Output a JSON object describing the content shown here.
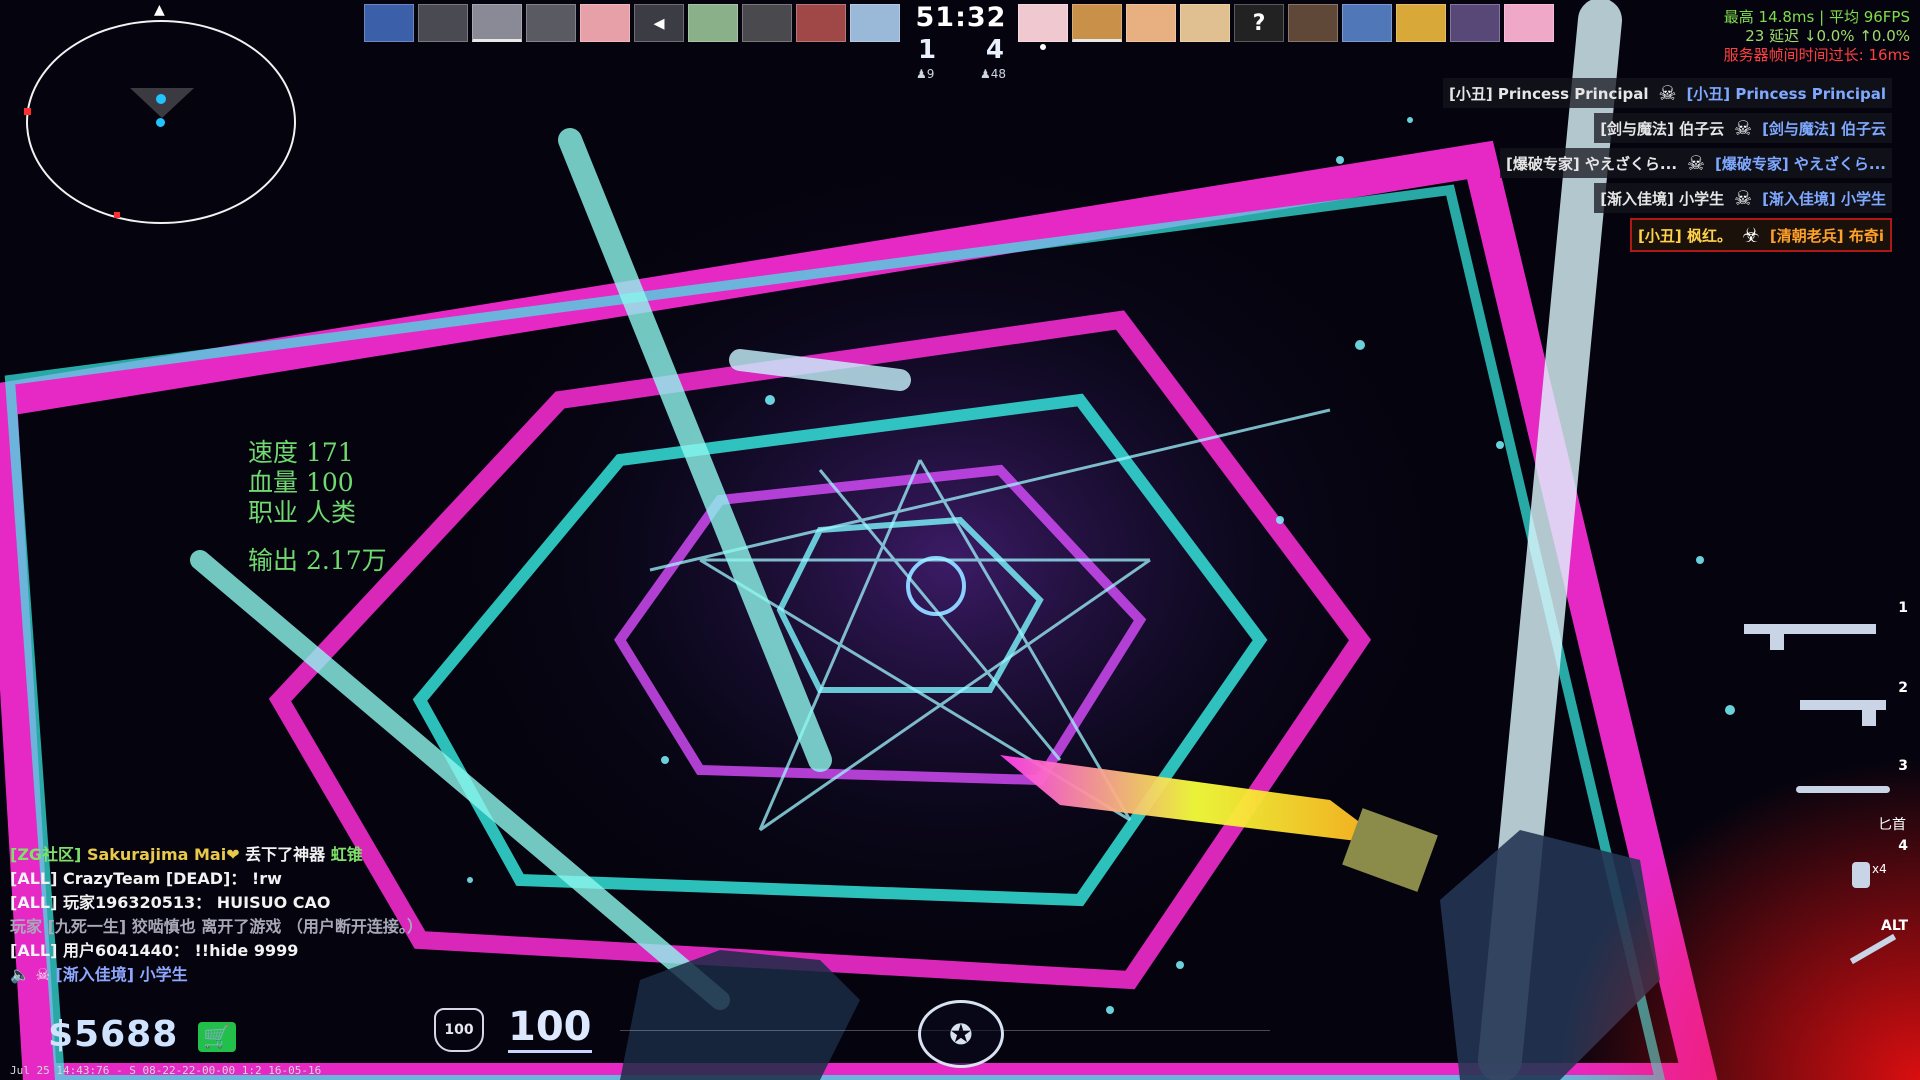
{
  "minimap": {
    "north_marker": "▲"
  },
  "scoreboard": {
    "timer": "51:32",
    "score_left": "1",
    "score_right": "4",
    "alive_left": "♟9",
    "alive_right": "♟48",
    "unknown_avatar": "?"
  },
  "netstats": {
    "line1": "最高 14.8ms | 平均 96FPS",
    "line2": "23 延迟 ↓0.0% ↑0.0%",
    "line3": "服务器帧间时间过长: 16ms"
  },
  "killfeed": [
    {
      "attacker": "[小丑] Princess Principal",
      "victim": "[小丑] Princess Principal",
      "icon": "☠"
    },
    {
      "attacker": "[剑与魔法] 伯子云",
      "victim": "[剑与魔法] 伯子云",
      "icon": "☠"
    },
    {
      "attacker": "[爆破专家] やえざくら...",
      "victim": "[爆破专家] やえざくら...",
      "icon": "☠"
    },
    {
      "attacker": "[渐入佳境] 小学生",
      "victim": "[渐入佳境] 小学生",
      "icon": "☠"
    },
    {
      "attacker": "[小丑] 枫红。",
      "victim": "[清朝老兵] 布奇i",
      "icon": "☣"
    }
  ],
  "player_stats": {
    "speed": "速度 171",
    "hp": "血量 100",
    "class": "职业 人类",
    "output": "输出 2.17万"
  },
  "chat": [
    {
      "segments": [
        {
          "text": "[ZG社区] ",
          "color": "c-green"
        },
        {
          "text": "Sakurajima Mai❤ ",
          "color": "c-gold"
        },
        {
          "text": "丢下了神器 ",
          "color": "c-white"
        },
        {
          "text": "虹锥",
          "color": "c-green"
        }
      ]
    },
    {
      "segments": [
        {
          "text": "[ALL] CrazyTeam [DEAD]： !rw",
          "color": "c-white"
        }
      ]
    },
    {
      "segments": [
        {
          "text": "[ALL] 玩家196320513： HUISUO CAO",
          "color": "c-white"
        }
      ]
    },
    {
      "segments": [
        {
          "text": "玩家 [九死一生] 狡啮慎也 离开了游戏 （用户断开连接。）",
          "color": "c-gray"
        }
      ]
    },
    {
      "segments": [
        {
          "text": "[ALL] 用户6041440： !!hide 9999",
          "color": "c-white"
        }
      ]
    },
    {
      "segments": [
        {
          "text": "🔈 ☠ ",
          "color": "c-white"
        },
        {
          "text": "[渐入佳境] 小学生",
          "color": "c-blue"
        }
      ]
    }
  ],
  "hud": {
    "money": "$5688",
    "cart_icon": "🛒",
    "armor": "100",
    "health": "100",
    "emblem": "✪",
    "timestamp": "Jul 25 14:43:76 - S 08-22-22-00-00 1:2 16-05-16"
  },
  "weapons": {
    "slot1": "1",
    "slot2": "2",
    "slot3": "3",
    "slot3_label": "匕首",
    "slot4": "4",
    "slot4_count": "x4",
    "slot_alt": "ALT"
  },
  "colors": {
    "magenta": "#ff2ed8",
    "cyan": "#37f0e6",
    "violet": "#b36bff",
    "health_text": "#6fd86f"
  }
}
